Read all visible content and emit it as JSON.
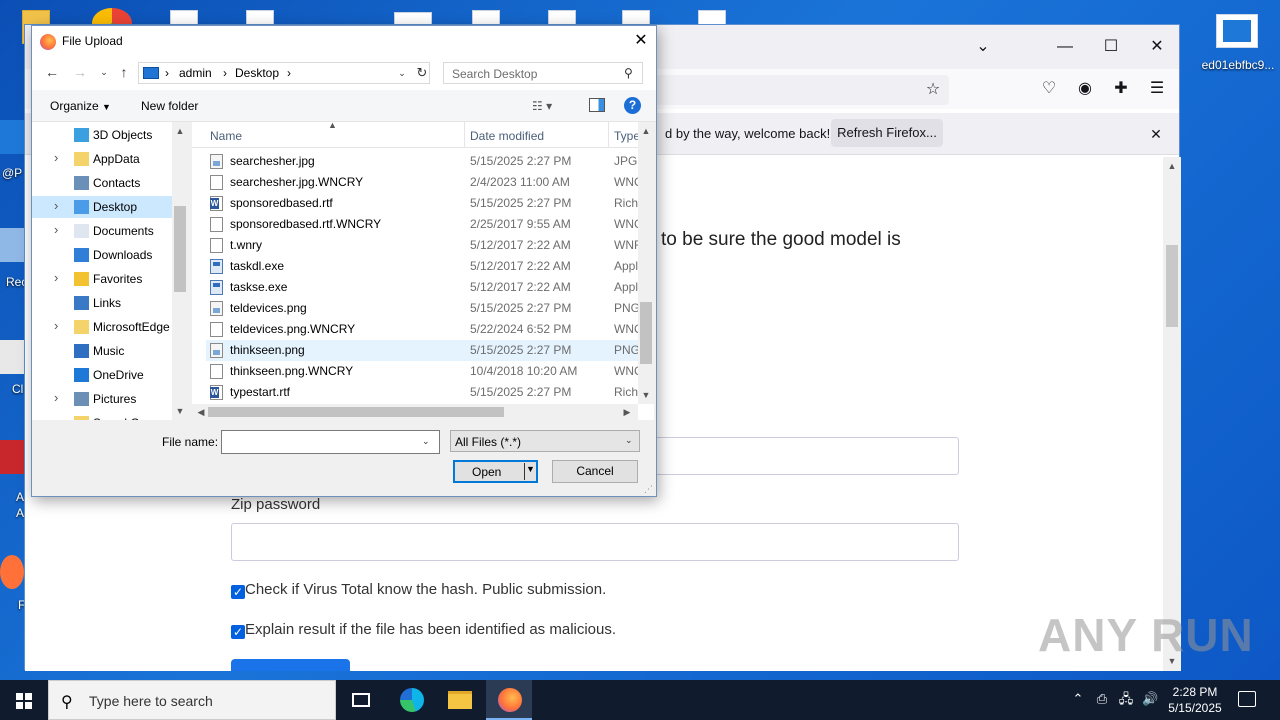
{
  "desktop": {
    "right_icon_label": "ed01ebfbc9...",
    "left_fragments": [
      "@P",
      "Rec",
      "Cl",
      "A",
      "A",
      "F"
    ]
  },
  "browser": {
    "notification_text": "d by the way, welcome back!",
    "refresh_button": "Refresh Firefox...",
    "content_text": "to be sure the good model is",
    "zip_label": "Zip password",
    "check1": "Check if Virus Total know the hash. Public submission.",
    "check2": "Explain result if the file has been identified as malicious.",
    "watermark": "ANY RUN"
  },
  "dialog": {
    "title": "File Upload",
    "breadcrumb": [
      "admin",
      "Desktop"
    ],
    "search_placeholder": "Search Desktop",
    "organize": "Organize",
    "new_folder": "New folder",
    "tree": [
      {
        "label": "3D Objects",
        "icon": "3d-objects-icon",
        "chevron": false,
        "selected": false
      },
      {
        "label": "AppData",
        "icon": "folder-icon",
        "chevron": true,
        "selected": false
      },
      {
        "label": "Contacts",
        "icon": "contacts-icon",
        "chevron": false,
        "selected": false
      },
      {
        "label": "Desktop",
        "icon": "desktop-icon",
        "chevron": true,
        "selected": true
      },
      {
        "label": "Documents",
        "icon": "documents-icon",
        "chevron": true,
        "selected": false
      },
      {
        "label": "Downloads",
        "icon": "downloads-icon",
        "chevron": false,
        "selected": false
      },
      {
        "label": "Favorites",
        "icon": "star-icon",
        "chevron": true,
        "selected": false
      },
      {
        "label": "Links",
        "icon": "links-icon",
        "chevron": false,
        "selected": false
      },
      {
        "label": "MicrosoftEdge",
        "icon": "folder-icon",
        "chevron": true,
        "selected": false
      },
      {
        "label": "Music",
        "icon": "music-icon",
        "chevron": false,
        "selected": false
      },
      {
        "label": "OneDrive",
        "icon": "cloud-icon",
        "chevron": false,
        "selected": false
      },
      {
        "label": "Pictures",
        "icon": "pictures-icon",
        "chevron": true,
        "selected": false
      },
      {
        "label": "Saved Games",
        "icon": "folder-icon",
        "chevron": false,
        "selected": false
      }
    ],
    "columns": {
      "name": "Name",
      "date": "Date modified",
      "type": "Type"
    },
    "files": [
      {
        "name": "searchesher.jpg",
        "date": "5/15/2025 2:27 PM",
        "type": "JPG F",
        "icon": "img",
        "selected": false
      },
      {
        "name": "searchesher.jpg.WNCRY",
        "date": "2/4/2023 11:00 AM",
        "type": "WNC",
        "icon": "file",
        "selected": false
      },
      {
        "name": "sponsoredbased.rtf",
        "date": "5/15/2025 2:27 PM",
        "type": "Rich",
        "icon": "doc",
        "selected": false
      },
      {
        "name": "sponsoredbased.rtf.WNCRY",
        "date": "2/25/2017 9:55 AM",
        "type": "WNC",
        "icon": "file",
        "selected": false
      },
      {
        "name": "t.wnry",
        "date": "5/12/2017 2:22 AM",
        "type": "WNF",
        "icon": "file",
        "selected": false
      },
      {
        "name": "taskdl.exe",
        "date": "5/12/2017 2:22 AM",
        "type": "Appl",
        "icon": "exe",
        "selected": false
      },
      {
        "name": "taskse.exe",
        "date": "5/12/2017 2:22 AM",
        "type": "Appl",
        "icon": "exe",
        "selected": false
      },
      {
        "name": "teldevices.png",
        "date": "5/15/2025 2:27 PM",
        "type": "PNG",
        "icon": "img",
        "selected": false
      },
      {
        "name": "teldevices.png.WNCRY",
        "date": "5/22/2024 6:52 PM",
        "type": "WNC",
        "icon": "file",
        "selected": false
      },
      {
        "name": "thinkseen.png",
        "date": "5/15/2025 2:27 PM",
        "type": "PNG",
        "icon": "img",
        "selected": true
      },
      {
        "name": "thinkseen.png.WNCRY",
        "date": "10/4/2018 10:20 AM",
        "type": "WNC",
        "icon": "file",
        "selected": false
      },
      {
        "name": "typestart.rtf",
        "date": "5/15/2025 2:27 PM",
        "type": "Rich",
        "icon": "doc",
        "selected": false
      }
    ],
    "filename_label": "File name:",
    "filename_value": "",
    "filter": "All Files (*.*)",
    "open": "Open",
    "cancel": "Cancel"
  },
  "taskbar": {
    "search_placeholder": "Type here to search",
    "time": "2:28 PM",
    "date": "5/15/2025"
  }
}
